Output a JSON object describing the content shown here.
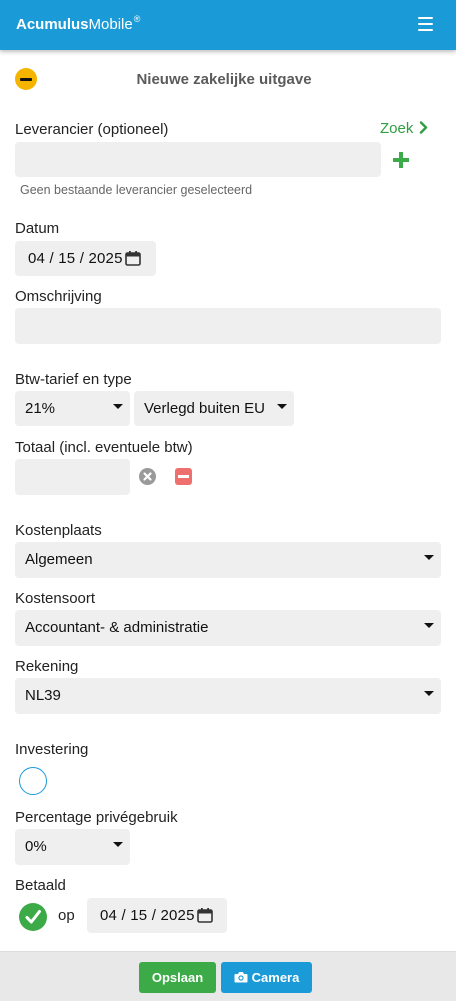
{
  "app": {
    "title_bold": "Acumulus",
    "title_rest": "Mobile",
    "title_mark": "®"
  },
  "header": {
    "title": "Nieuwe zakelijke uitgave"
  },
  "supplier": {
    "label": "Leverancier (optioneel)",
    "search_link": "Zoek",
    "value": "",
    "hint": "Geen bestaande leverancier geselecteerd"
  },
  "date": {
    "label": "Datum",
    "month": "04",
    "day": "15",
    "year": "2025",
    "sep": "/"
  },
  "description": {
    "label": "Omschrijving",
    "value": ""
  },
  "vat": {
    "label": "Btw-tarief en type",
    "rate": "21%",
    "type": "Verlegd buiten EU"
  },
  "total": {
    "label": "Totaal (incl. eventuele btw)",
    "value": ""
  },
  "cost_center": {
    "label": "Kostenplaats",
    "value": "Algemeen"
  },
  "cost_type": {
    "label": "Kostensoort",
    "value": "Accountant- & administratie"
  },
  "account": {
    "label": "Rekening",
    "value": "NL39"
  },
  "investment": {
    "label": "Investering",
    "checked": false
  },
  "private_use": {
    "label": "Percentage privégebruik",
    "value": "0%"
  },
  "paid": {
    "label": "Betaald",
    "checked": true,
    "on_label": "op",
    "month": "04",
    "day": "15",
    "year": "2025",
    "sep": "/"
  },
  "footer": {
    "save_label": "Opslaan",
    "camera_label": "Camera"
  },
  "colors": {
    "header": "#1a9ad6",
    "green": "#3daa48",
    "blue": "#1a9ad6",
    "collapse": "#f5b400",
    "remove": "#ef6f6f"
  },
  "icons": [
    "menu-icon",
    "collapse-icon",
    "chevron-right-icon",
    "plus-icon",
    "calendar-icon",
    "clear-icon",
    "remove-icon",
    "checkmark-icon",
    "camera-icon"
  ]
}
